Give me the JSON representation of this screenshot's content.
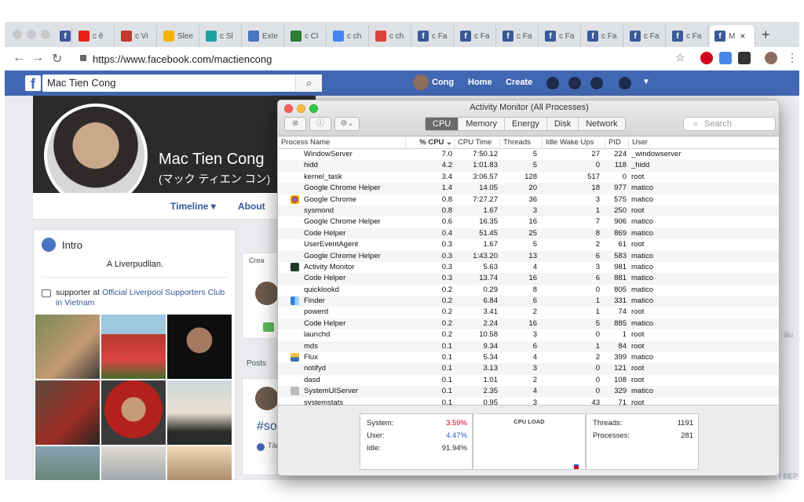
{
  "browser": {
    "tabs": [
      {
        "label": "",
        "icon": "facebook-icon",
        "color": "#3b5998"
      },
      {
        "label": "c ê",
        "icon": "youtube-icon",
        "color": "#e62117"
      },
      {
        "label": "c Vi",
        "icon": "ebook-icon",
        "color": "#c0392b"
      },
      {
        "label": "Slee",
        "icon": "drive-icon",
        "color": "#f4b400"
      },
      {
        "label": "c Sl",
        "icon": "snowflake-icon",
        "color": "#1aa3a3"
      },
      {
        "label": "Exte",
        "icon": "puzzle-icon",
        "color": "#4a76c1"
      },
      {
        "label": "c Cl",
        "icon": "leaf-icon",
        "color": "#2e7d32"
      },
      {
        "label": "c ch",
        "icon": "google-icon",
        "color": "#4285f4"
      },
      {
        "label": "c ch",
        "icon": "chrome-icon",
        "color": "#db4437"
      },
      {
        "label": "c Fa",
        "icon": "facebook-icon",
        "color": "#3b5998"
      },
      {
        "label": "c Fa",
        "icon": "facebook-icon",
        "color": "#3b5998"
      },
      {
        "label": "c Fa",
        "icon": "facebook-icon",
        "color": "#3b5998"
      },
      {
        "label": "c Fa",
        "icon": "facebook-icon",
        "color": "#3b5998"
      },
      {
        "label": "c Fa",
        "icon": "facebook-icon",
        "color": "#3b5998"
      },
      {
        "label": "c Fa",
        "icon": "facebook-icon",
        "color": "#3b5998"
      },
      {
        "label": "c Fa",
        "icon": "facebook-icon",
        "color": "#3b5998"
      },
      {
        "label": "M",
        "icon": "facebook-icon",
        "color": "#3b5998",
        "active": true
      }
    ],
    "url": "https://www.facebook.com/mactiencong"
  },
  "facebook": {
    "search_value": "Mac Tien Cong",
    "nav": {
      "user": "Cong",
      "home": "Home",
      "create": "Create"
    },
    "profile": {
      "name": "Mac Tien Cong",
      "subname": "(マック ティエン コン)"
    },
    "profile_tabs": {
      "timeline": "Timeline ▾",
      "about": "About"
    },
    "intro": {
      "title": "Intro",
      "bio": "A Liverpudlian.",
      "supporter_prefix": "supporter at ",
      "supporter_link": "Official Liverpool Supporters Club in Vietnam"
    },
    "composer_label": "Crea",
    "posts_label": "Posts",
    "hashtag": "#so",
    "reaction_label": "Tâm",
    "right_fragment_1": "lầu",
    "right_fragment_2": "I ĐẸP"
  },
  "activity_monitor": {
    "title": "Activity Monitor (All Processes)",
    "tabs": [
      "CPU",
      "Memory",
      "Energy",
      "Disk",
      "Network"
    ],
    "active_tab": "CPU",
    "search_placeholder": "Search",
    "columns": [
      "Process Name",
      "% CPU ⌄",
      "CPU Time",
      "Threads",
      "Idle Wake Ups",
      "PID",
      "User"
    ],
    "processes": [
      {
        "name": "WindowServer",
        "cpu": "7.0",
        "time": "7:50.12",
        "threads": "5",
        "wake": "27",
        "pid": "224",
        "user": "_windowserver",
        "icon": ""
      },
      {
        "name": "hidd",
        "cpu": "4.2",
        "time": "1:01.83",
        "threads": "5",
        "wake": "0",
        "pid": "118",
        "user": "_hidd",
        "icon": ""
      },
      {
        "name": "kernel_task",
        "cpu": "3.4",
        "time": "3:06.57",
        "threads": "128",
        "wake": "517",
        "pid": "0",
        "user": "root",
        "icon": ""
      },
      {
        "name": "Google Chrome Helper",
        "cpu": "1.4",
        "time": "14.05",
        "threads": "20",
        "wake": "18",
        "pid": "977",
        "user": "matico",
        "icon": ""
      },
      {
        "name": "Google Chrome",
        "cpu": "0.8",
        "time": "7:27.27",
        "threads": "36",
        "wake": "3",
        "pid": "575",
        "user": "matico",
        "icon": "chrome-icon"
      },
      {
        "name": "sysmond",
        "cpu": "0.8",
        "time": "1.67",
        "threads": "3",
        "wake": "1",
        "pid": "250",
        "user": "root",
        "icon": ""
      },
      {
        "name": "Google Chrome Helper",
        "cpu": "0.6",
        "time": "16.35",
        "threads": "16",
        "wake": "7",
        "pid": "906",
        "user": "matico",
        "icon": ""
      },
      {
        "name": "Code Helper",
        "cpu": "0.4",
        "time": "51.45",
        "threads": "25",
        "wake": "8",
        "pid": "869",
        "user": "matico",
        "icon": ""
      },
      {
        "name": "UserEventAgent",
        "cpu": "0.3",
        "time": "1.67",
        "threads": "5",
        "wake": "2",
        "pid": "61",
        "user": "root",
        "icon": ""
      },
      {
        "name": "Google Chrome Helper",
        "cpu": "0.3",
        "time": "1:43.20",
        "threads": "13",
        "wake": "6",
        "pid": "583",
        "user": "matico",
        "icon": ""
      },
      {
        "name": "Activity Monitor",
        "cpu": "0.3",
        "time": "5.63",
        "threads": "4",
        "wake": "3",
        "pid": "981",
        "user": "matico",
        "icon": "activity-monitor-icon"
      },
      {
        "name": "Code Helper",
        "cpu": "0.3",
        "time": "13.74",
        "threads": "16",
        "wake": "6",
        "pid": "881",
        "user": "matico",
        "icon": ""
      },
      {
        "name": "quicklookd",
        "cpu": "0.2",
        "time": "0.29",
        "threads": "8",
        "wake": "0",
        "pid": "805",
        "user": "matico",
        "icon": ""
      },
      {
        "name": "Finder",
        "cpu": "0.2",
        "time": "6.84",
        "threads": "6",
        "wake": "1",
        "pid": "331",
        "user": "matico",
        "icon": "finder-icon"
      },
      {
        "name": "powerd",
        "cpu": "0.2",
        "time": "3.41",
        "threads": "2",
        "wake": "1",
        "pid": "74",
        "user": "root",
        "icon": ""
      },
      {
        "name": "Code Helper",
        "cpu": "0.2",
        "time": "2.24",
        "threads": "16",
        "wake": "5",
        "pid": "885",
        "user": "matico",
        "icon": ""
      },
      {
        "name": "launchd",
        "cpu": "0.2",
        "time": "10.58",
        "threads": "3",
        "wake": "0",
        "pid": "1",
        "user": "root",
        "icon": ""
      },
      {
        "name": "mds",
        "cpu": "0.1",
        "time": "9.34",
        "threads": "6",
        "wake": "1",
        "pid": "84",
        "user": "root",
        "icon": ""
      },
      {
        "name": "Flux",
        "cpu": "0.1",
        "time": "5.34",
        "threads": "4",
        "wake": "2",
        "pid": "399",
        "user": "matico",
        "icon": "flux-icon"
      },
      {
        "name": "notifyd",
        "cpu": "0.1",
        "time": "3.13",
        "threads": "3",
        "wake": "0",
        "pid": "121",
        "user": "root",
        "icon": ""
      },
      {
        "name": "dasd",
        "cpu": "0.1",
        "time": "1.01",
        "threads": "2",
        "wake": "0",
        "pid": "108",
        "user": "root",
        "icon": ""
      },
      {
        "name": "SystemUIServer",
        "cpu": "0.1",
        "time": "2.35",
        "threads": "4",
        "wake": "0",
        "pid": "329",
        "user": "matico",
        "icon": "systemui-icon"
      },
      {
        "name": "systemstats",
        "cpu": "0.1",
        "time": "0.95",
        "threads": "3",
        "wake": "43",
        "pid": "71",
        "user": "root",
        "icon": ""
      }
    ],
    "stats": {
      "system_label": "System:",
      "system_value": "3.59%",
      "user_label": "User:",
      "user_value": "4.47%",
      "idle_label": "Idle:",
      "idle_value": "91.94%",
      "cpu_load_label": "CPU LOAD",
      "threads_label": "Threads:",
      "threads_value": "1191",
      "processes_label": "Processes:",
      "processes_value": "281"
    },
    "colors": {
      "system": "#d0021b",
      "user": "#2a5bd7",
      "selected_tab": "#6b6b6b"
    }
  }
}
